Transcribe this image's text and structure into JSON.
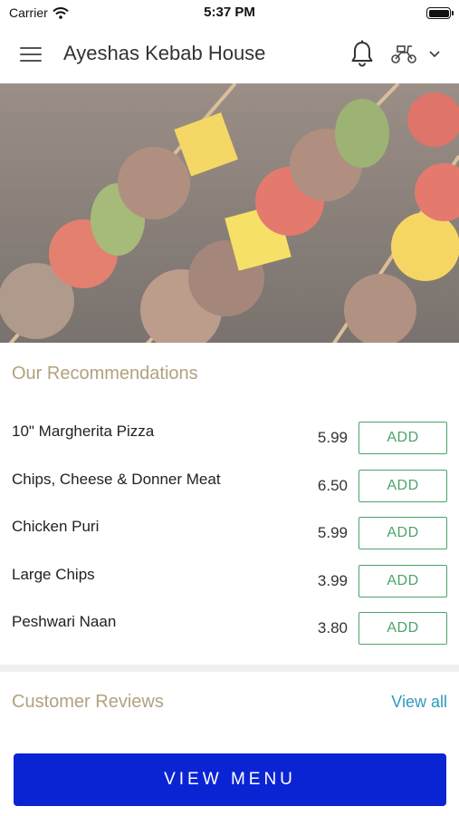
{
  "status_bar": {
    "carrier": "Carrier",
    "time": "5:37 PM"
  },
  "header": {
    "title": "Ayeshas Kebab House",
    "icons": [
      "menu-icon",
      "bell-icon",
      "scooter-icon",
      "chevron-down-icon"
    ]
  },
  "recommendations": {
    "title": "Our Recommendations",
    "items": [
      {
        "name": "10\" Margherita Pizza",
        "price": "5.99",
        "button": "ADD"
      },
      {
        "name": "Chips, Cheese & Donner Meat",
        "price": "6.50",
        "button": "ADD"
      },
      {
        "name": "Chicken Puri",
        "price": "5.99",
        "button": "ADD"
      },
      {
        "name": "Large Chips",
        "price": "3.99",
        "button": "ADD"
      },
      {
        "name": "Peshwari Naan",
        "price": "3.80",
        "button": "ADD"
      }
    ]
  },
  "reviews": {
    "title": "Customer Reviews",
    "view_all": "View all"
  },
  "footer": {
    "button": "VIEW MENU"
  },
  "colors": {
    "accent_gold": "#b2a17f",
    "add_green": "#4aa468",
    "link_blue": "#2f9bbf",
    "primary_button": "#0a24d4"
  }
}
